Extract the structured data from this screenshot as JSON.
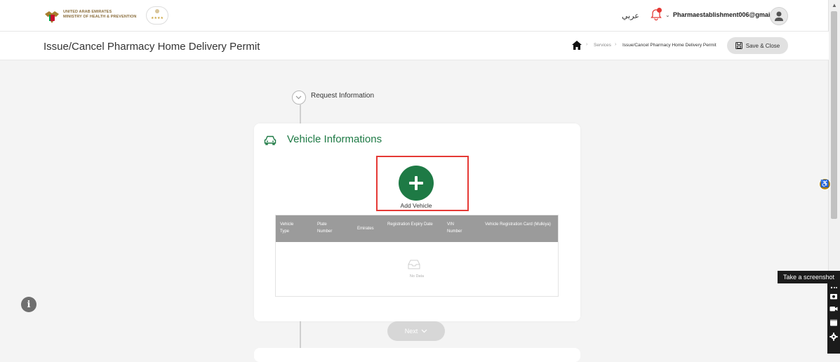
{
  "header": {
    "logo_line1": "UNITED ARAB EMIRATES",
    "logo_line2": "MINISTRY OF HEALTH & PREVENTION",
    "language_toggle": "عربي",
    "user_email": "Pharmaestablishment006@gmail.com"
  },
  "page": {
    "title": "Issue/Cancel Pharmacy Home Delivery Permit",
    "save_label": "Save & Close"
  },
  "breadcrumb": {
    "items": [
      "Services",
      "Issue/Cancel Pharmacy Home Delivery Permit"
    ]
  },
  "steps": {
    "request_information": "Request Information"
  },
  "vehicle": {
    "title": "Vehicle Informations",
    "add_label": "Add Vehicle",
    "columns": [
      "Vehicle Type",
      "Plate Number",
      "Emirates",
      "Registration Expiry Date",
      "VIN Number",
      "Vehicle Registration Card (Mulkiya)"
    ],
    "empty_text": "No Data"
  },
  "actions": {
    "next_label": "Next"
  },
  "tools": {
    "tooltip": "Take a screenshot"
  },
  "colors": {
    "accent_green": "#1e7a45",
    "highlight_red": "#e53935"
  }
}
